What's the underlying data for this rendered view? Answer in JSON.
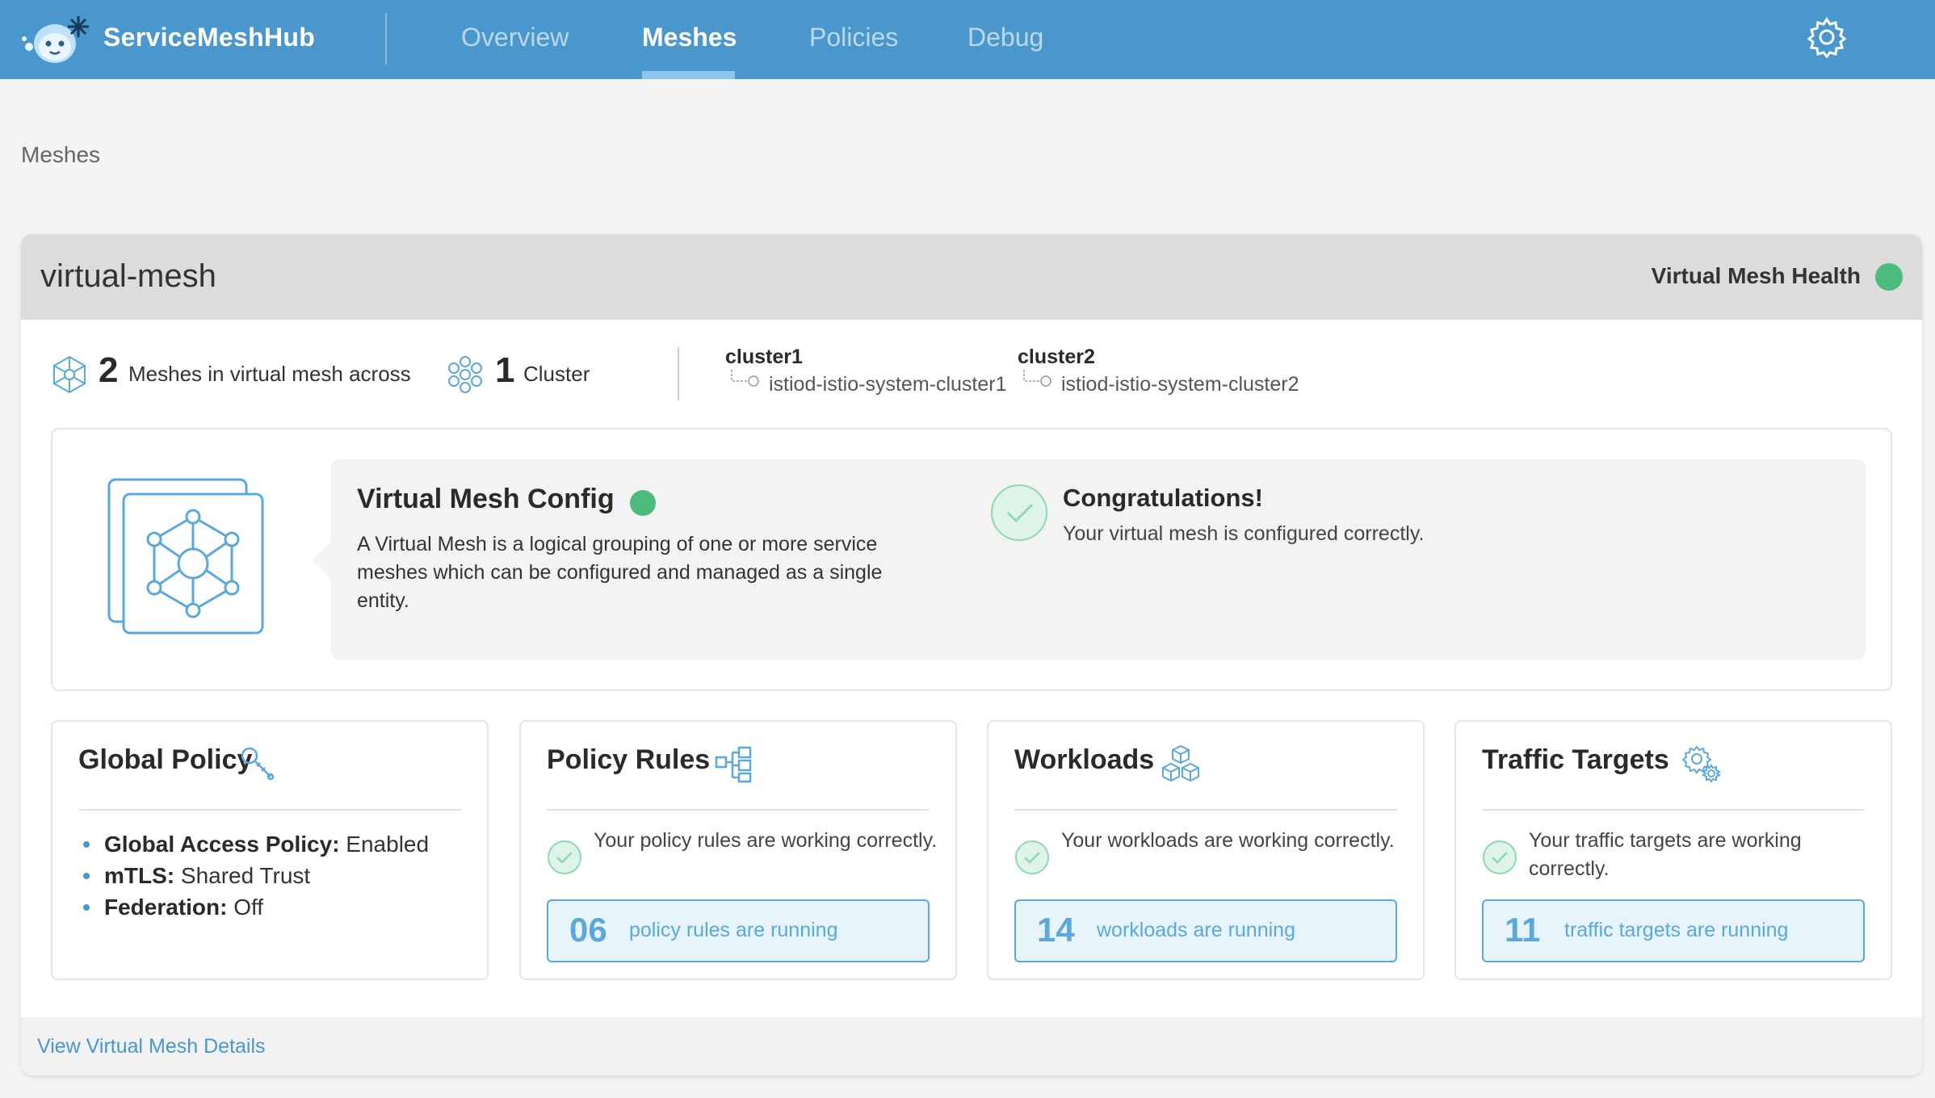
{
  "app": {
    "name": "ServiceMeshHub"
  },
  "nav": {
    "items": [
      {
        "label": "Overview",
        "active": false
      },
      {
        "label": "Meshes",
        "active": true
      },
      {
        "label": "Policies",
        "active": false
      },
      {
        "label": "Debug",
        "active": false
      }
    ],
    "settings_icon": "gear-icon"
  },
  "breadcrumb": "Meshes",
  "virtual_mesh": {
    "name": "virtual-mesh",
    "health_label": "Virtual Mesh Health",
    "health_status_color": "#4cbb7b",
    "summary": {
      "mesh_count": "2",
      "mesh_text": "Meshes in virtual mesh across",
      "cluster_count": "1",
      "cluster_text": "Cluster"
    },
    "clusters": [
      {
        "name": "cluster1",
        "mesh": "istiod-istio-system-cluster1"
      },
      {
        "name": "cluster2",
        "mesh": "istiod-istio-system-cluster2"
      }
    ],
    "config": {
      "title": "Virtual Mesh Config",
      "description": "A Virtual Mesh is a logical grouping of one or more service meshes which can be configured and managed as a single entity.",
      "status_title": "Congratulations!",
      "status_text": "Your virtual mesh is configured correctly."
    },
    "global_policy": {
      "title": "Global Policy",
      "items": [
        {
          "key": "Global Access Policy:",
          "value": " Enabled"
        },
        {
          "key": "mTLS:",
          "value": " Shared Trust"
        },
        {
          "key": "Federation:",
          "value": " Off"
        }
      ]
    },
    "policy_rules": {
      "title": "Policy Rules",
      "status": "Your policy rules are working correctly.",
      "count": "06",
      "count_label": "policy rules are running"
    },
    "workloads": {
      "title": "Workloads",
      "status": "Your workloads are working correctly.",
      "count": "14",
      "count_label": "workloads are running"
    },
    "traffic_targets": {
      "title": "Traffic Targets",
      "status": "Your traffic targets are working correctly.",
      "count": "11",
      "count_label": "traffic targets are running"
    },
    "details_link": "View Virtual Mesh Details"
  },
  "colors": {
    "brand": "#4a97cd",
    "healthy": "#4cbb7b",
    "accent_light": "#e7f4fc"
  }
}
